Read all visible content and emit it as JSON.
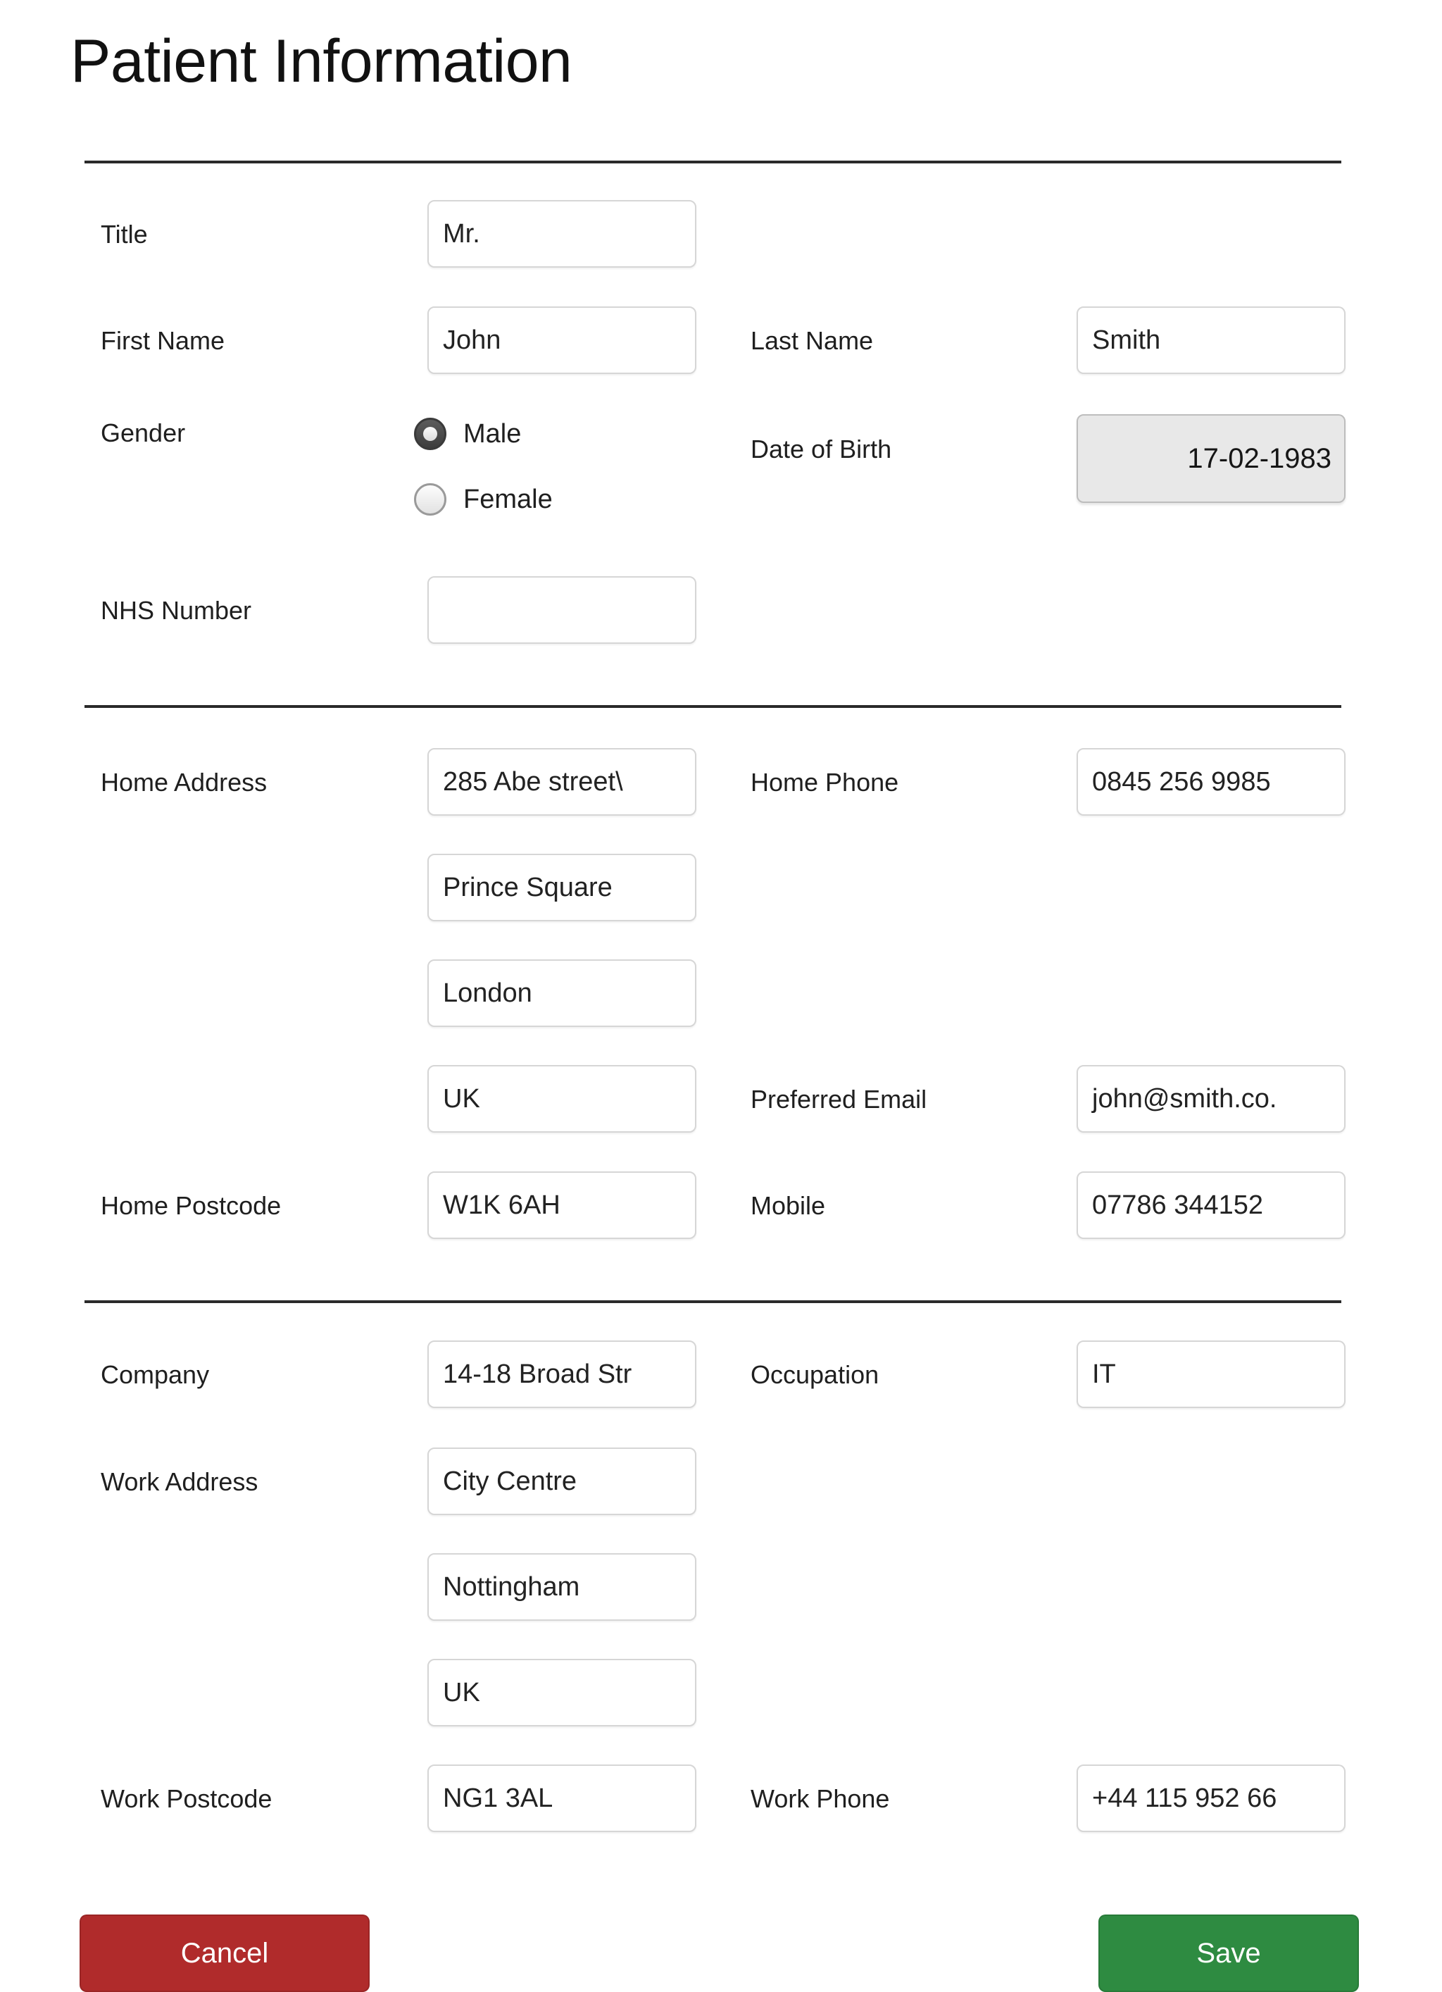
{
  "header": {
    "title": "Patient Information"
  },
  "sections": {
    "personal": {
      "title_label": "Title",
      "title_value": "Mr.",
      "first_name_label": "First Name",
      "first_name_value": "John",
      "last_name_label": "Last Name",
      "last_name_value": "Smith",
      "gender_label": "Gender",
      "gender_options": [
        {
          "label": "Male",
          "selected": true
        },
        {
          "label": "Female",
          "selected": false
        }
      ],
      "dob_label": "Date of Birth",
      "dob_value": "17-02-1983",
      "nhs_label": "NHS Number",
      "nhs_value": ""
    },
    "home": {
      "address_label": "Home Address",
      "address_line1": "285 Abe street\\",
      "address_line2": "Prince Square",
      "address_line3": "London",
      "address_line4": "UK",
      "postcode_label": "Home Postcode",
      "postcode_value": "W1K 6AH",
      "home_phone_label": "Home Phone",
      "home_phone_value": "0845 256 9985",
      "email_label": "Preferred Email",
      "email_value": "john@smith.co.",
      "mobile_label": "Mobile",
      "mobile_value": "07786 344152"
    },
    "work": {
      "company_label": "Company",
      "company_value": "14-18 Broad Str",
      "occupation_label": "Occupation",
      "occupation_value": "IT",
      "address_label": "Work Address",
      "address_line1": "City Centre",
      "address_line2": "Nottingham",
      "address_line3": "UK",
      "postcode_label": "Work Postcode",
      "postcode_value": "NG1 3AL",
      "work_phone_label": "Work Phone",
      "work_phone_value": "+44 115 952 66"
    }
  },
  "actions": {
    "cancel_label": "Cancel",
    "save_label": "Save",
    "cancel_color": "#b02b2b",
    "save_color": "#2e8b41"
  }
}
